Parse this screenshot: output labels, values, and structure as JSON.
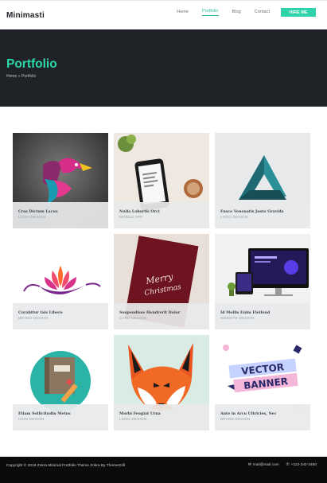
{
  "brand": "Minimasti",
  "nav": {
    "items": [
      "Home",
      "Portfolio",
      "Blog",
      "Contact"
    ],
    "active": 1,
    "hire_label": "HIRE ME"
  },
  "hero": {
    "title": "Portfolio",
    "breadcrumb": "Home » Portfolio"
  },
  "portfolio": [
    {
      "title": "Cras Dictum Lacus",
      "category": "LOGO DESIGN",
      "icon": "bird-logo"
    },
    {
      "title": "Nulla Lobortis Orci",
      "category": "MOBILE APP",
      "icon": "phone-mockup"
    },
    {
      "title": "Fusce Venenatis Justo Gravida",
      "category": "LOGO DESIGN",
      "icon": "penrose-triangle"
    },
    {
      "title": "Curabitur Iais Libero",
      "category": "BRAND DESIGN",
      "icon": "lotus-logo"
    },
    {
      "title": "Suspendisse Hendrerit Dolor",
      "category": "CARD DESIGN",
      "icon": "christmas-card"
    },
    {
      "title": "Id Mollis Enim Eleifend",
      "category": "WEBSITE DESIGN",
      "icon": "desktop-mockup"
    },
    {
      "title": "Etiam Sollicitudin Metus",
      "category": "ICON DESIGN",
      "icon": "notebook-icon"
    },
    {
      "title": "Morbi Feugiat Urna",
      "category": "LOGO DESIGN",
      "icon": "fox-logo"
    },
    {
      "title": "Ante in Arcu Ultricies, Nec",
      "category": "BRAND DESIGN",
      "icon": "vector-banner"
    }
  ],
  "art": {
    "card_text_1": "Merry",
    "card_text_2": "Christmas",
    "banner_1": "VECTOR",
    "banner_2": "BANNER",
    "phone_text": "I design and develop experiences that make people's lives simple."
  },
  "footer": {
    "copyright": "Copyright © 2019 Zokra Minimal Portfolio Theme Zokra By ThemeGrill",
    "email": "mail@mail.com",
    "phone": "+112-342-3450"
  },
  "colors": {
    "accent": "#2fd3ab",
    "hero_bg": "#1f2327",
    "footer_bg": "#0b0b0b"
  }
}
